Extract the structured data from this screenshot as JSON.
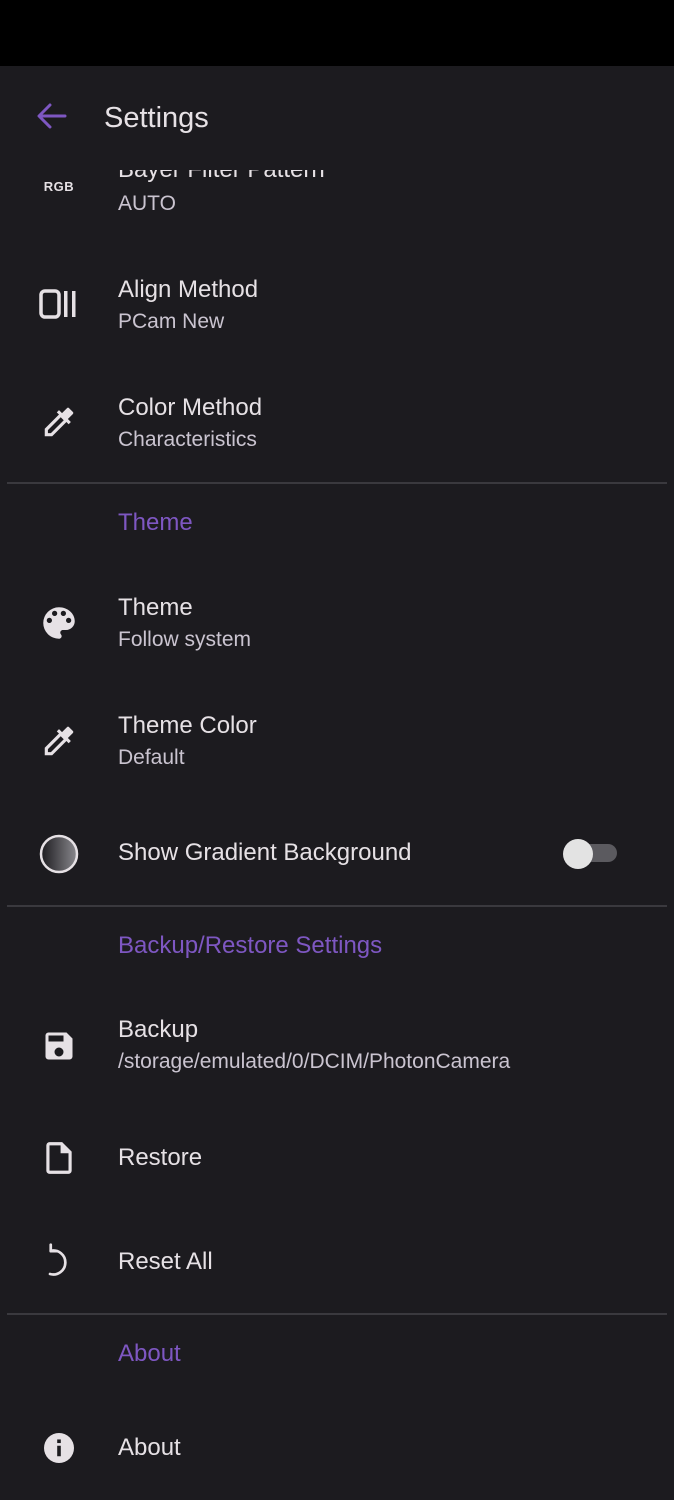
{
  "app_bar": {
    "title": "Settings"
  },
  "items": {
    "bayer": {
      "icon_text": "RGB",
      "title": "Bayer Filter Pattern",
      "summary": "AUTO"
    },
    "align": {
      "title": "Align Method",
      "summary": "PCam New"
    },
    "color_method": {
      "title": "Color Method",
      "summary": "Characteristics"
    }
  },
  "theme_section": {
    "header": "Theme",
    "theme": {
      "title": "Theme",
      "summary": "Follow system"
    },
    "theme_color": {
      "title": "Theme Color",
      "summary": "Default"
    },
    "gradient": {
      "title": "Show Gradient Background",
      "enabled": false
    }
  },
  "backup_section": {
    "header": "Backup/Restore Settings",
    "backup": {
      "title": "Backup",
      "summary": "/storage/emulated/0/DCIM/PhotonCamera"
    },
    "restore": {
      "title": "Restore"
    },
    "reset": {
      "title": "Reset All"
    }
  },
  "about_section": {
    "header": "About",
    "about": {
      "title": "About"
    }
  },
  "colors": {
    "accent": "#7e57c2",
    "background": "#1c1b1f",
    "text": "#e6e1e5",
    "secondary_text": "#cac4d0"
  }
}
